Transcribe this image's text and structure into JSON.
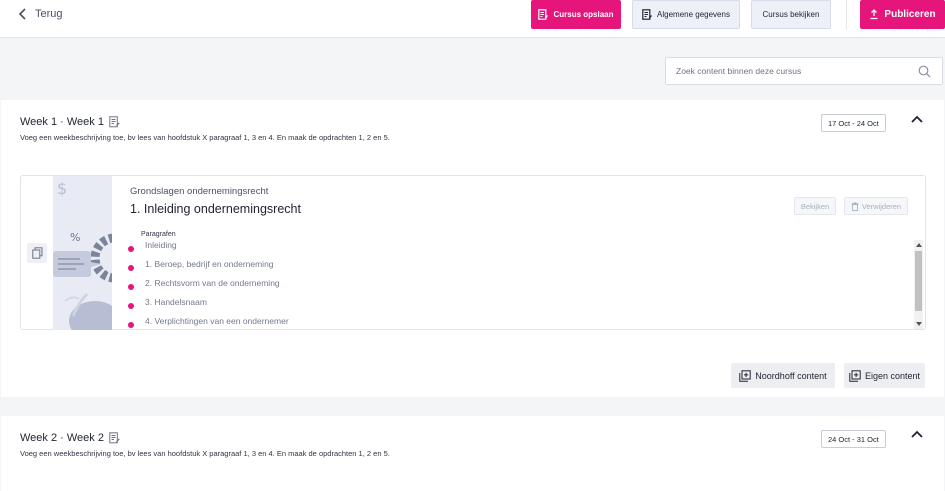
{
  "header": {
    "back_label": "Terug",
    "save_label": "Cursus opslaan",
    "general_label": "Algemene gegevens",
    "view_label": "Cursus bekijken",
    "publish_label": "Publiceren"
  },
  "search": {
    "placeholder": "Zoek content binnen deze cursus"
  },
  "weeks": [
    {
      "title": "Week 1 · Week 1",
      "description": "Voeg een weekbeschrijving toe, bv lees van hoofdstuk X paragraaf 1, 3 en 4. En maak de opdrachten 1, 2 en 5.",
      "date_range": "17 Oct - 24 Oct",
      "content": {
        "subject": "Grondslagen ondernemingsrecht",
        "title": "1. Inleiding ondernemingsrecht",
        "view_label": "Bekijken",
        "delete_label": "Verwijderen",
        "paragraphs_label": "Paragrafen",
        "paragraphs": [
          "Inleiding",
          "1. Beroep, bedrijf en onderneming",
          "2. Rechtsvorm van de onderneming",
          "3. Handelsnaam",
          "4. Verplichtingen van een ondernemer"
        ]
      },
      "add_noordhoff_label": "Noordhoff content",
      "add_own_label": "Eigen content"
    },
    {
      "title": "Week 2 · Week 2",
      "description": "Voeg een weekbeschrijving toe, bv lees van hoofdstuk X paragraaf 1, 3 en 4. En maak de opdrachten 1, 2 en 5.",
      "date_range": "24 Oct - 31 Oct"
    }
  ],
  "colors": {
    "accent": "#e5157b",
    "bullet": "#e5157b",
    "background": "#f4f5f7"
  }
}
